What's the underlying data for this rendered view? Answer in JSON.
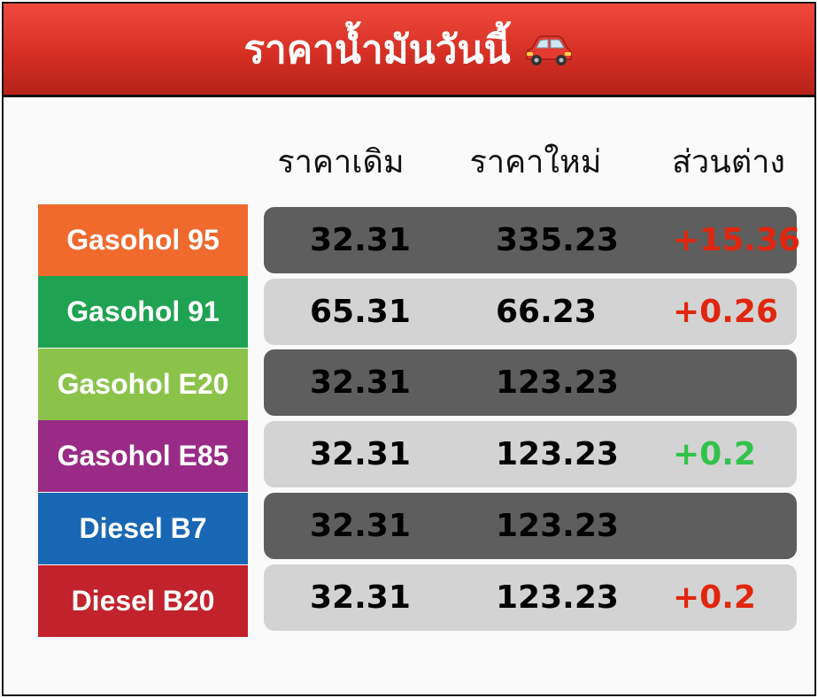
{
  "header": {
    "title": "ราคาน้ำมันวันนี้",
    "icon": "red-car-icon"
  },
  "columns": {
    "old_price": "ราคาเดิม",
    "new_price": "ราคาใหม่",
    "difference": "ส่วนต่าง"
  },
  "colors": {
    "header_red": "#d62f24",
    "dark_row": "#5e5e5e",
    "light_row": "#d3d3d3",
    "increase": "#e0260e",
    "decrease": "#33c24a"
  },
  "fuels": [
    {
      "name": "Gasohol 95",
      "color": "#f06a2e",
      "old": "32.31",
      "new": "335.23",
      "diff": "+15.36",
      "diff_dir": "up"
    },
    {
      "name": "Gasohol 91",
      "color": "#1fa352",
      "old": "65.31",
      "new": "66.23",
      "diff": "+0.26",
      "diff_dir": "up"
    },
    {
      "name": "Gasohol E20",
      "color": "#8bc34a",
      "old": "32.31",
      "new": "123.23",
      "diff": "",
      "diff_dir": ""
    },
    {
      "name": "Gasohol E85",
      "color": "#992a86",
      "old": "32.31",
      "new": "123.23",
      "diff": "+0.2",
      "diff_dir": "down"
    },
    {
      "name": "Diesel B7",
      "color": "#1867b5",
      "old": "32.31",
      "new": "123.23",
      "diff": "",
      "diff_dir": ""
    },
    {
      "name": "Diesel B20",
      "color": "#c1222b",
      "old": "32.31",
      "new": "123.23",
      "diff": "+0.2",
      "diff_dir": "up"
    }
  ]
}
